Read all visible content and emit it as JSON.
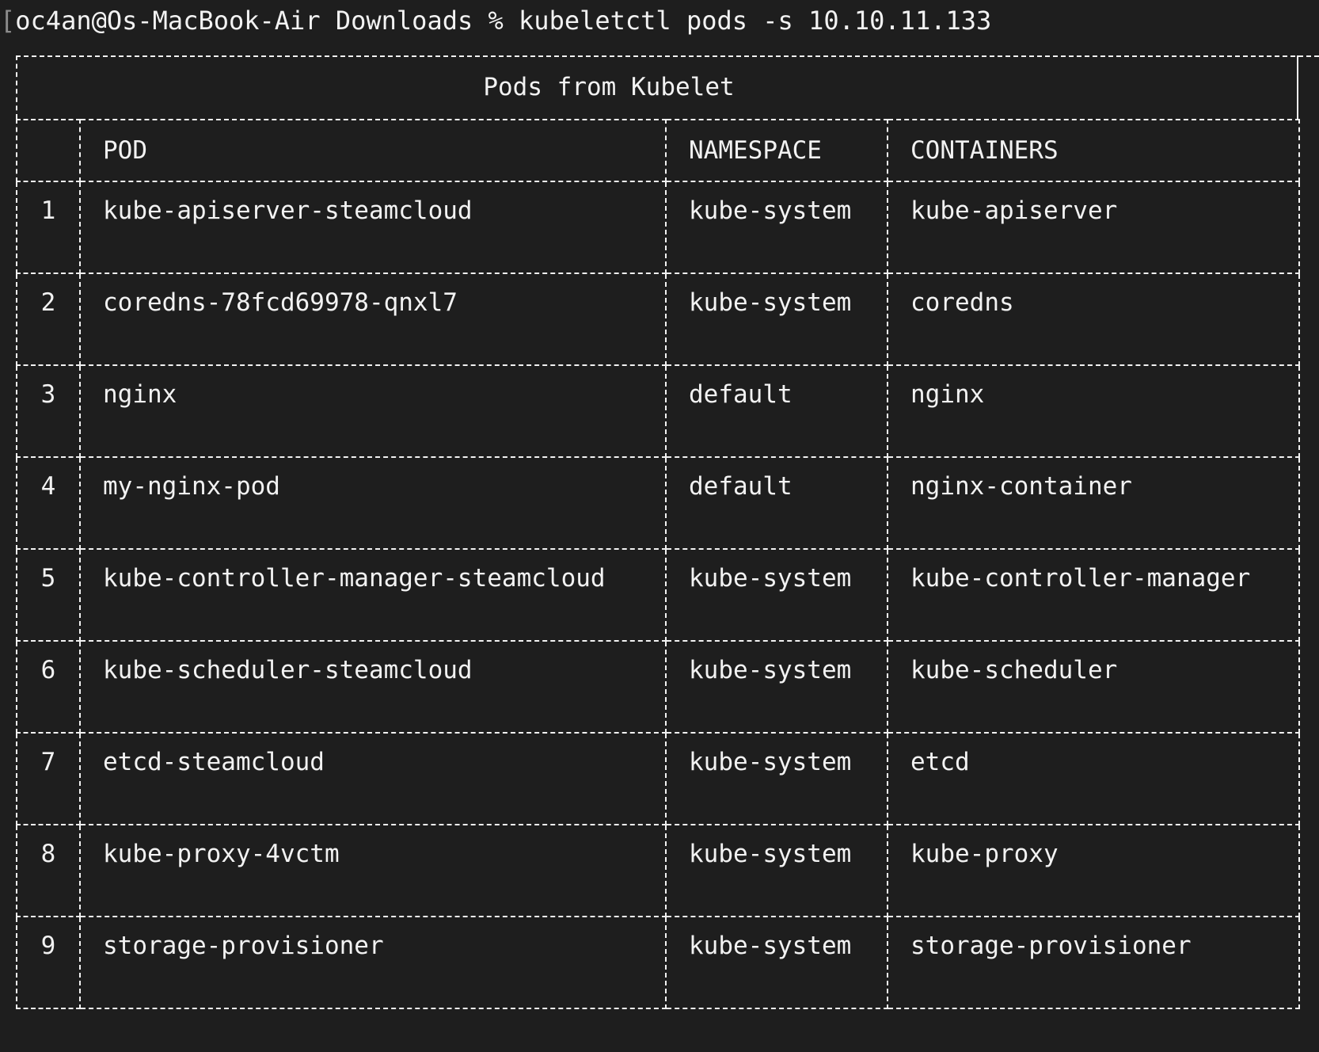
{
  "terminal": {
    "cursor_glyph": "[",
    "prompt": "oc4an@Os-MacBook-Air Downloads % ",
    "command": "kubeletctl pods -s 10.10.11.133"
  },
  "table": {
    "title": "Pods from Kubelet",
    "columns": [
      "",
      "POD",
      "NAMESPACE",
      "CONTAINERS"
    ],
    "rows": [
      {
        "index": "1",
        "pod": "kube-apiserver-steamcloud",
        "namespace": "kube-system",
        "containers": "kube-apiserver"
      },
      {
        "index": "2",
        "pod": "coredns-78fcd69978-qnxl7",
        "namespace": "kube-system",
        "containers": "coredns"
      },
      {
        "index": "3",
        "pod": "nginx",
        "namespace": "default",
        "containers": "nginx"
      },
      {
        "index": "4",
        "pod": "my-nginx-pod",
        "namespace": "default",
        "containers": "nginx-container"
      },
      {
        "index": "5",
        "pod": "kube-controller-manager-steamcloud",
        "namespace": "kube-system",
        "containers": "kube-controller-manager"
      },
      {
        "index": "6",
        "pod": "kube-scheduler-steamcloud",
        "namespace": "kube-system",
        "containers": "kube-scheduler"
      },
      {
        "index": "7",
        "pod": "etcd-steamcloud",
        "namespace": "kube-system",
        "containers": "etcd"
      },
      {
        "index": "8",
        "pod": "kube-proxy-4vctm",
        "namespace": "kube-system",
        "containers": "kube-proxy"
      },
      {
        "index": "9",
        "pod": "storage-provisioner",
        "namespace": "kube-system",
        "containers": "storage-provisioner"
      }
    ]
  },
  "colors": {
    "background": "#1e1e1e",
    "foreground": "#f2f2f2"
  }
}
